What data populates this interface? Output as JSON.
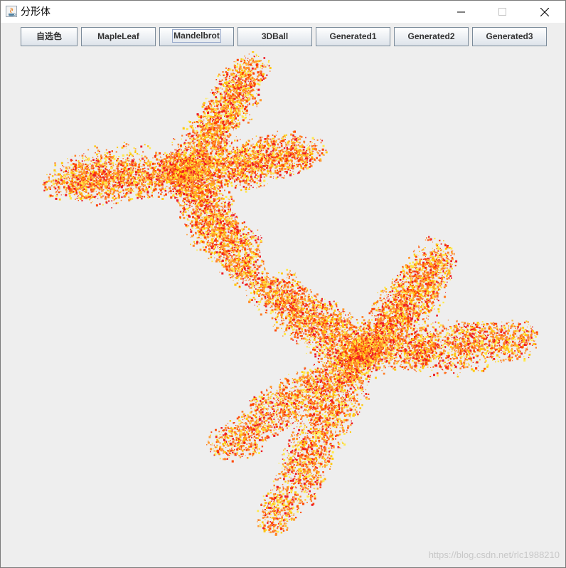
{
  "window": {
    "title": "分形体"
  },
  "toolbar": {
    "buttons": [
      {
        "label": "自选色"
      },
      {
        "label": "MapleLeaf"
      },
      {
        "label": "Mandelbrot"
      },
      {
        "label": "3DBall"
      },
      {
        "label": "Generated1"
      },
      {
        "label": "Generated2"
      },
      {
        "label": "Generated3"
      }
    ],
    "focused_index": 2
  },
  "canvas": {
    "background": "#eeeeee",
    "palette": [
      "#ff7f27",
      "#ff4500",
      "#ed1c24",
      "#ffc90e",
      "#ffe94d",
      "#ff9a30"
    ]
  },
  "watermark": "https://blog.csdn.net/rlc1988210"
}
